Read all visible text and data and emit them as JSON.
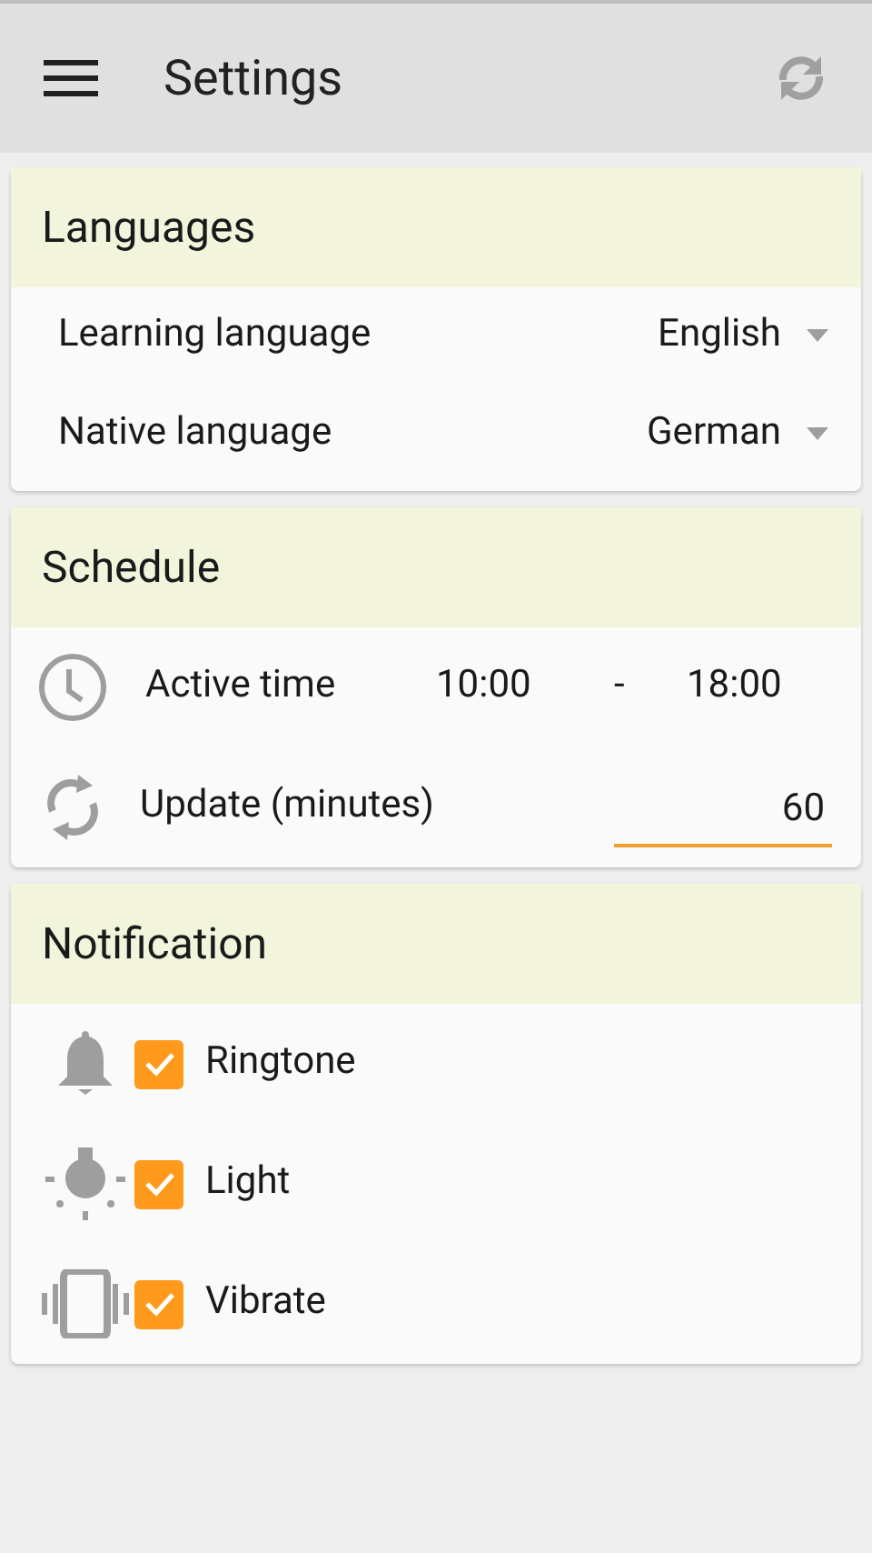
{
  "app_bar": {
    "title": "Settings"
  },
  "languages": {
    "title": "Languages",
    "rows": [
      {
        "label": "Learning language",
        "value": "English"
      },
      {
        "label": "Native language",
        "value": "German"
      }
    ]
  },
  "schedule": {
    "title": "Schedule",
    "active_time": {
      "label": "Active time",
      "start": "10:00",
      "separator": "-",
      "end": "18:00"
    },
    "update": {
      "label": "Update (minutes)",
      "value": "60"
    }
  },
  "notification": {
    "title": "Notification",
    "items": [
      {
        "label": "Ringtone",
        "checked": true
      },
      {
        "label": "Light",
        "checked": true
      },
      {
        "label": "Vibrate",
        "checked": true
      }
    ]
  }
}
